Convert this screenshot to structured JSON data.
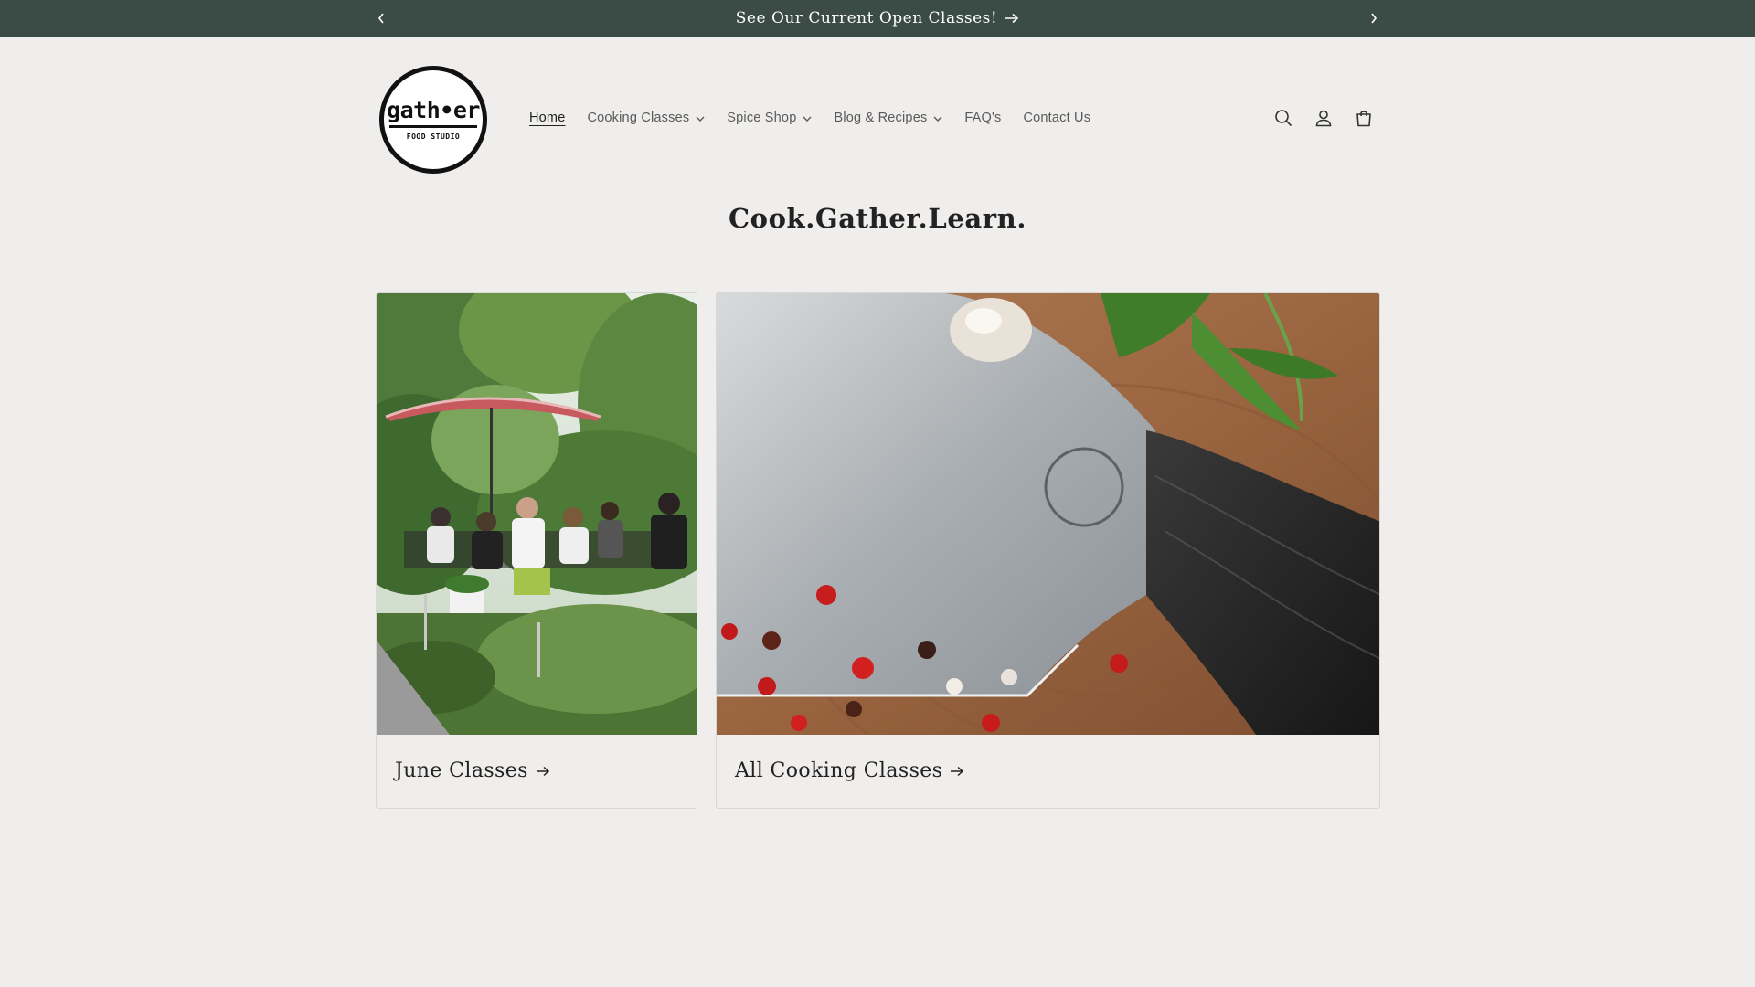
{
  "announcement": {
    "text": "See Our Current Open Classes!",
    "arrow": "→",
    "prev_icon": "chevron-left-icon",
    "next_icon": "chevron-right-icon",
    "background": "#3b4b45"
  },
  "header": {
    "logo": {
      "word": "gath•er",
      "sub": "FOOD STUDIO"
    },
    "nav": [
      {
        "label": "Home",
        "active": true
      },
      {
        "label": "Cooking Classes",
        "dropdown": true
      },
      {
        "label": "Spice Shop",
        "dropdown": true
      },
      {
        "label": "Blog & Recipes",
        "dropdown": true
      },
      {
        "label": "FAQ's"
      },
      {
        "label": "Contact Us"
      }
    ],
    "icons": [
      "search-icon",
      "account-icon",
      "cart-icon"
    ]
  },
  "main": {
    "tagline": "Cook.Gather.Learn.",
    "cards": [
      {
        "title": "June Classes",
        "arrow": "→",
        "image": "outdoor-dinner-photo"
      },
      {
        "title": "All Cooking Classes",
        "arrow": "→",
        "image": "knife-cutting-board-photo"
      }
    ]
  }
}
